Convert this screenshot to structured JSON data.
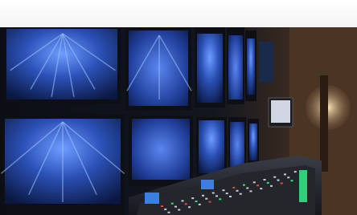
{
  "image": {
    "subject": "broadcast-control-room",
    "colors": {
      "screen_glow": "#3b6bd6",
      "screen_dark": "#0a1a4a",
      "bezel": "#111318",
      "console": "#2a2c33",
      "led_green": "#35e07a",
      "led_red": "#e24a3c",
      "warm_light": "#d9b27a"
    }
  }
}
